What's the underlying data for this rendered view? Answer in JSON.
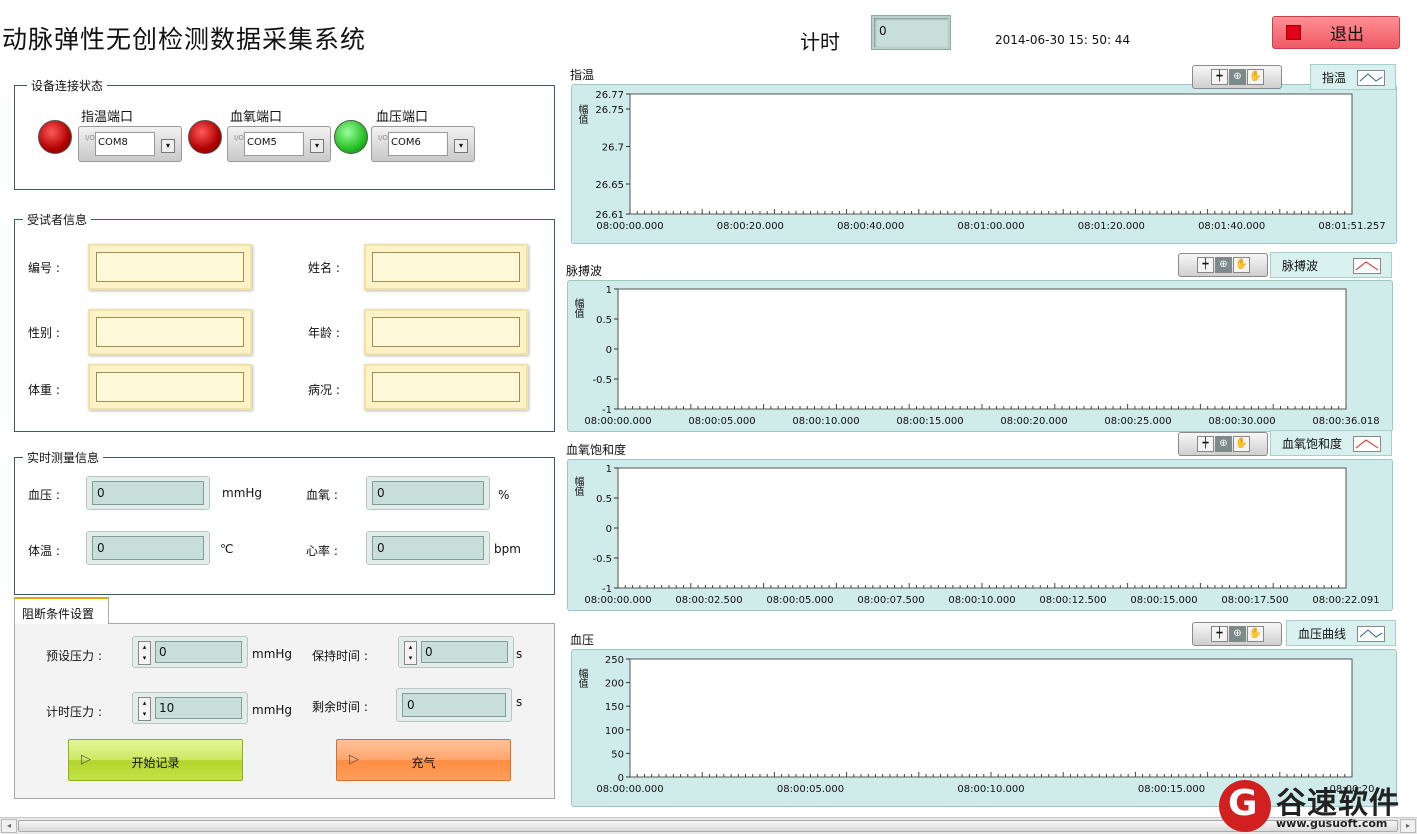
{
  "app": {
    "title": "动脉弹性无创检测数据采集系统",
    "timer_label": "计时",
    "timer_value": "0",
    "datetime": "2014-06-30  15: 50: 44",
    "exit_label": "退出"
  },
  "device": {
    "group_title": "设备连接状态",
    "ports": [
      {
        "label": "指温端口",
        "value": "COM8",
        "status": "red"
      },
      {
        "label": "血氧端口",
        "value": "COM5",
        "status": "red"
      },
      {
        "label": "血压端口",
        "value": "COM6",
        "status": "green"
      }
    ],
    "io_glyph": "I/O",
    "dropdown_arrow": "▾"
  },
  "subject": {
    "group_title": "受试者信息",
    "fields": {
      "id": "编号 :",
      "name": "姓名 :",
      "gender": "性别 :",
      "age": "年龄 :",
      "weight": "体重 :",
      "condition": "病况 :"
    }
  },
  "realtime": {
    "group_title": "实时测量信息",
    "bp_label": "血压 :",
    "bp_value": "0",
    "bp_unit": "mmHg",
    "spo2_label": "血氧 :",
    "spo2_value": "0",
    "spo2_unit": "%",
    "temp_label": "体温 :",
    "temp_value": "0",
    "temp_unit": "℃",
    "hr_label": "心率 :",
    "hr_value": "0",
    "hr_unit": "bpm"
  },
  "block": {
    "tab_label": "阻断条件设置",
    "preset_pressure_label": "预设压力 :",
    "preset_pressure_value": "0",
    "preset_pressure_unit": "mmHg",
    "hold_time_label": "保持时间 :",
    "hold_time_value": "0",
    "hold_time_unit": "s",
    "timer_pressure_label": "计时压力 :",
    "timer_pressure_value": "10",
    "timer_pressure_unit": "mmHg",
    "remain_time_label": "剩余时间 :",
    "remain_time_value": "0",
    "remain_time_unit": "s",
    "start_label": "开始记录",
    "inflate_label": "充气",
    "play_glyph": "▷"
  },
  "toolbar_glyphs": {
    "cursor": "┿",
    "zoom": "⊕",
    "pan": "✋"
  },
  "charts": {
    "temp": {
      "title": "指温",
      "legend": "指温",
      "ylabel": "幅值"
    },
    "pulse": {
      "title": "脉搏波",
      "legend": "脉搏波",
      "ylabel": "幅值"
    },
    "spo2": {
      "title": "血氧饱和度",
      "legend": "血氧饱和度",
      "ylabel": "幅值"
    },
    "bp": {
      "title": "血压",
      "legend": "血压曲线",
      "ylabel": "幅值"
    }
  },
  "chart_data": [
    {
      "type": "line",
      "title": "指温",
      "ylabel": "幅值",
      "yticks": [
        "26.77",
        "26.75",
        "26.7",
        "26.65",
        "26.61"
      ],
      "ylim": [
        26.61,
        26.77
      ],
      "xticks": [
        "08:00:00.000",
        "08:00:20.000",
        "08:00:40.000",
        "08:01:00.000",
        "08:01:20.000",
        "08:01:40.000",
        "08:01:51.257"
      ],
      "series": [
        {
          "name": "指温",
          "values": [],
          "color": "#2b5f9e"
        }
      ]
    },
    {
      "type": "line",
      "title": "脉搏波",
      "ylabel": "幅值",
      "yticks": [
        "1",
        "0.5",
        "0",
        "-0.5",
        "-1"
      ],
      "ylim": [
        -1,
        1
      ],
      "xticks": [
        "08:00:00.000",
        "08:00:05.000",
        "08:00:10.000",
        "08:00:15.000",
        "08:00:20.000",
        "08:00:25.000",
        "08:00:30.000",
        "08:00:36.018"
      ],
      "series": [
        {
          "name": "脉搏波",
          "values": [],
          "color": "#e02020"
        }
      ]
    },
    {
      "type": "line",
      "title": "血氧饱和度",
      "ylabel": "幅值",
      "yticks": [
        "1",
        "0.5",
        "0",
        "-0.5",
        "-1"
      ],
      "ylim": [
        -1,
        1
      ],
      "xticks": [
        "08:00:00.000",
        "08:00:02.500",
        "08:00:05.000",
        "08:00:07.500",
        "08:00:10.000",
        "08:00:12.500",
        "08:00:15.000",
        "08:00:17.500",
        "08:00:22.091"
      ],
      "series": [
        {
          "name": "血氧饱和度",
          "values": [],
          "color": "#e02020"
        }
      ]
    },
    {
      "type": "line",
      "title": "血压",
      "ylabel": "幅值",
      "yticks": [
        "250",
        "200",
        "150",
        "100",
        "50",
        "0"
      ],
      "ylim": [
        0,
        250
      ],
      "xticks": [
        "08:00:00.000",
        "08:00:05.000",
        "08:00:10.000",
        "08:00:15.000",
        "08:00:20"
      ],
      "series": [
        {
          "name": "血压曲线",
          "values": [],
          "color": "#2b5f9e"
        }
      ]
    }
  ],
  "scroll": {
    "left_arrow": "◂",
    "right_arrow": "▸"
  },
  "watermark": {
    "logo_letter": "G",
    "brand": "谷速软件",
    "url": "www.gusuoft.com"
  }
}
